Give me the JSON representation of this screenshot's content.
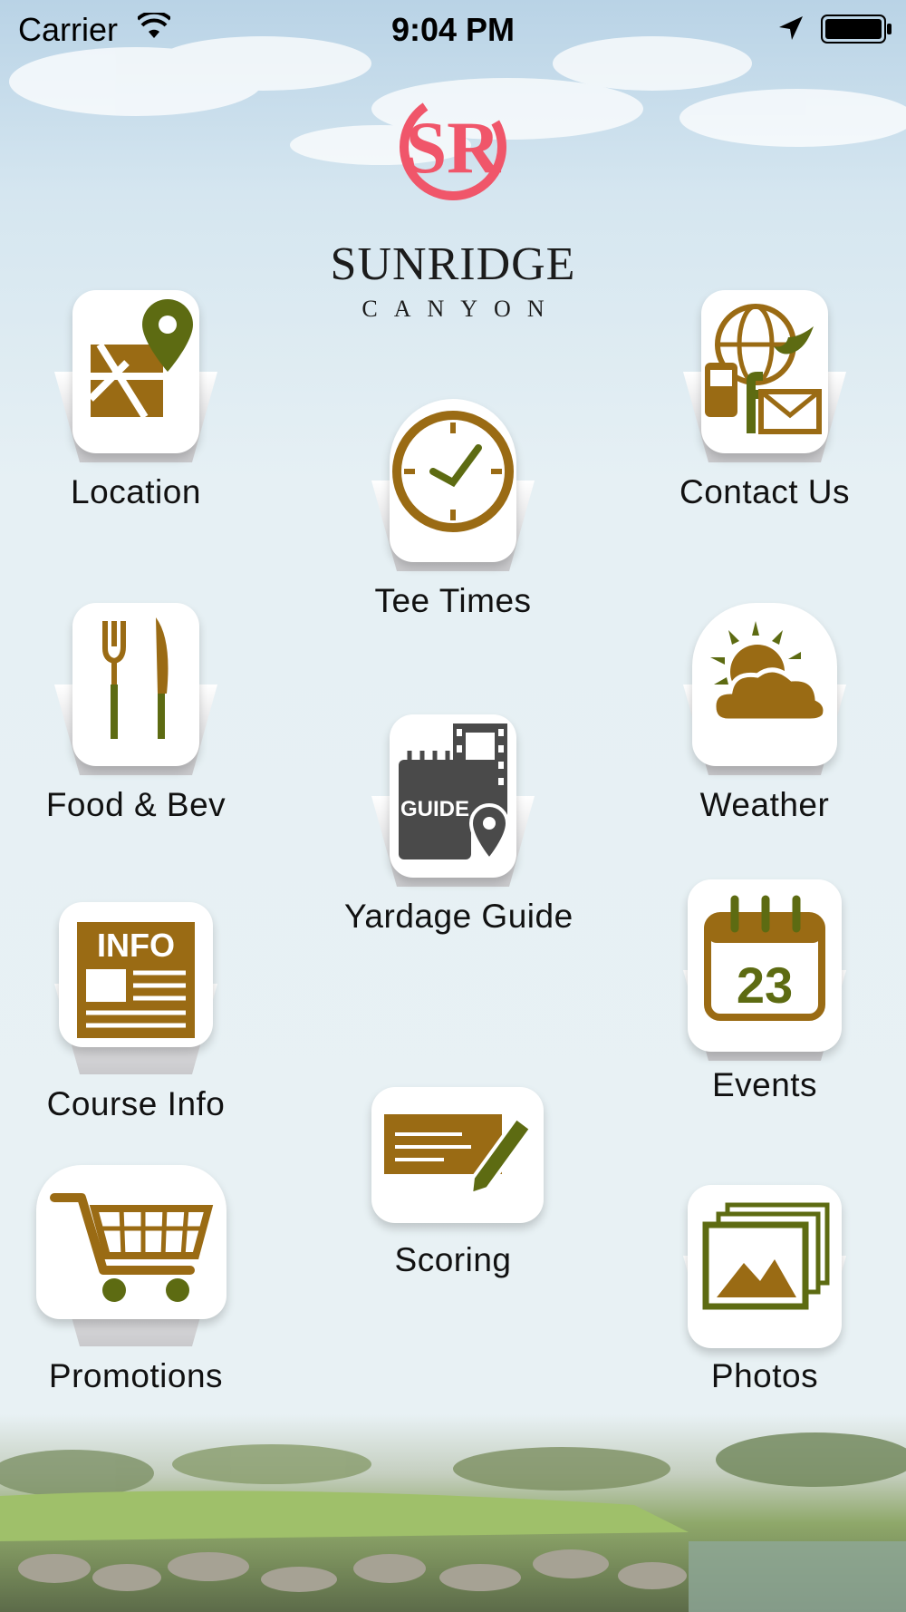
{
  "status_bar": {
    "carrier": "Carrier",
    "time": "9:04 PM"
  },
  "brand": {
    "monogram": "SR",
    "name": "SUNRIDGE",
    "subname": "CANYON",
    "accent_color": "#f0566a"
  },
  "colors": {
    "icon_gold": "#9a6b14",
    "icon_olive": "#5d6b12",
    "icon_gray": "#4a4a4a"
  },
  "menu": {
    "location": {
      "label": "Location",
      "icon": "map-pin-icon"
    },
    "tee_times": {
      "label": "Tee Times",
      "icon": "clock-icon"
    },
    "contact_us": {
      "label": "Contact Us",
      "icon": "contact-icon"
    },
    "food_bev": {
      "label": "Food & Bev",
      "icon": "fork-knife-icon"
    },
    "yardage_guide": {
      "label": "Yardage Guide",
      "icon": "guide-icon",
      "icon_text": "GUIDE"
    },
    "weather": {
      "label": "Weather",
      "icon": "weather-icon"
    },
    "course_info": {
      "label": "Course Info",
      "icon": "info-icon",
      "icon_text": "INFO"
    },
    "events": {
      "label": "Events",
      "icon": "calendar-icon",
      "icon_text": "23"
    },
    "scoring": {
      "label": "Scoring",
      "icon": "scorecard-icon"
    },
    "promotions": {
      "label": "Promotions",
      "icon": "cart-icon"
    },
    "photos": {
      "label": "Photos",
      "icon": "photos-icon"
    }
  }
}
